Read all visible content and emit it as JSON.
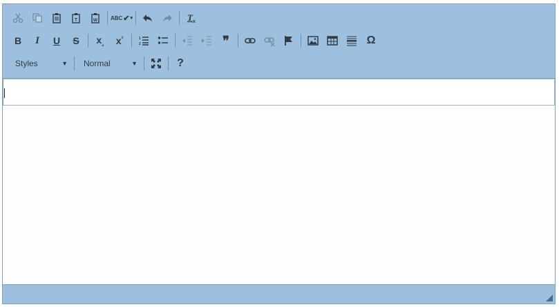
{
  "toolbar": {
    "row1": {
      "spellcheck_label": "ABC"
    },
    "row2": {
      "bold": "B",
      "italic": "I",
      "underline": "U",
      "strike": "S",
      "subscript": "x",
      "superscript": "x",
      "blockquote": "❞",
      "special_char": "Ω"
    },
    "row3": {
      "styles_label": "Styles",
      "format_value": "Normal",
      "help": "?"
    }
  },
  "icons": [
    "cut-icon",
    "copy-icon",
    "paste-icon",
    "paste-text-icon",
    "paste-word-icon",
    "spellcheck-icon",
    "undo-icon",
    "redo-icon",
    "remove-format-icon",
    "bold-icon",
    "italic-icon",
    "underline-icon",
    "strike-icon",
    "subscript-icon",
    "superscript-icon",
    "numbered-list-icon",
    "bulleted-list-icon",
    "outdent-icon",
    "indent-icon",
    "blockquote-icon",
    "link-icon",
    "unlink-icon",
    "anchor-icon",
    "image-icon",
    "table-icon",
    "horizontal-rule-icon",
    "special-char-icon",
    "maximize-icon",
    "help-icon",
    "resize-grip-icon"
  ],
  "colors": {
    "chrome": "#9dc0de",
    "border": "#7ba0c3",
    "content": "#fcfdfc",
    "icon": "#333a41"
  }
}
